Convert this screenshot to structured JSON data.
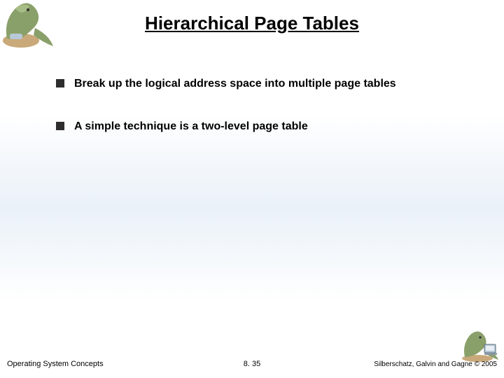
{
  "title": "Hierarchical Page Tables",
  "bullets": [
    "Break up the logical address space into multiple page tables",
    "A simple technique is a two-level page table"
  ],
  "footer": {
    "left": "Operating System Concepts",
    "center": "8. 35",
    "right": "Silberschatz, Galvin and Gagne © 2005"
  },
  "decor": {
    "top_left_icon": "dinosaur-illustration",
    "bottom_right_icon": "dinosaur-computer-illustration"
  }
}
